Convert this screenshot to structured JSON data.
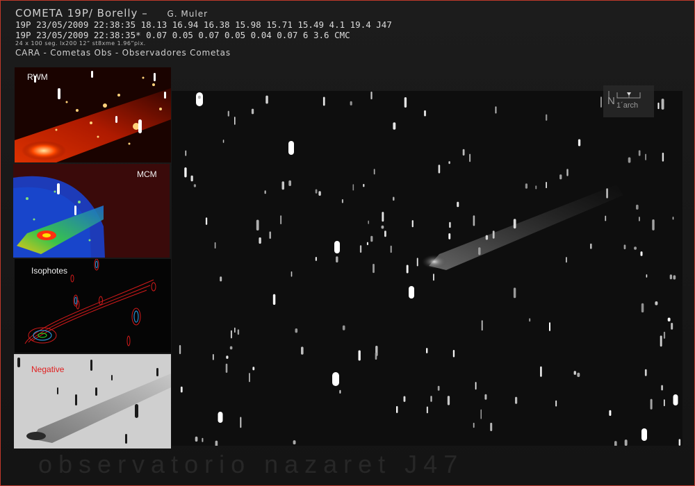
{
  "header": {
    "title": "COMETA 19P/  Borelly  –",
    "author": "G. Muler",
    "line1": "19P 23/05/2009 22:38:35 18.13 16.94 16.38 15.98 15.71 15.49 4.1 19.4 J47",
    "line2": "19P 23/05/2009 22:38:35* 0.07 0.05 0.07 0.05 0.04 0.07 6 3.6 CMC",
    "line3": "24 x 100 seg. lx200 12” st8xme 1.96”pix.",
    "line4": "CARA - Cometas Obs - Observadores Cometas"
  },
  "panels": {
    "rwm": "RWM",
    "mcm": "MCM",
    "isophotes": "Isophotes",
    "negative": "Negative"
  },
  "scale": {
    "north": "N",
    "label": "1´arch"
  },
  "footer": {
    "watermark": "observatorio nazaret J47"
  },
  "colors": {
    "frame": "#c0392b",
    "negative_label": "#e02020"
  }
}
